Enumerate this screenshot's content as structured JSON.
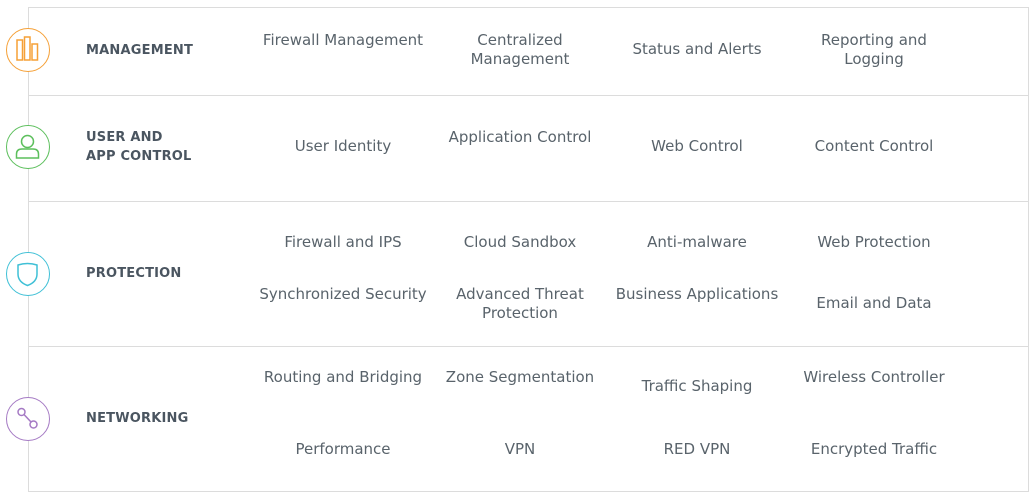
{
  "categories": {
    "management": {
      "label": "MANAGEMENT",
      "icon": "bar-chart-icon",
      "color": "#f5a037",
      "features": [
        "Firewall Management",
        "Centralized Management",
        "Status and Alerts",
        "Reporting and Logging"
      ]
    },
    "user_app_control": {
      "label_line1": "USER AND",
      "label_line2": "APP CONTROL",
      "icon": "user-icon",
      "color": "#5cbf5c",
      "features": [
        "User Identity",
        "Application Control",
        "Web Control",
        "Content Control"
      ]
    },
    "protection": {
      "label": "PROTECTION",
      "icon": "shield-icon",
      "color": "#3fc0d6",
      "features": [
        "Firewall and IPS",
        "Cloud Sandbox",
        "Anti-malware",
        "Web Protection",
        "Synchronized Security",
        "Advanced Threat Protection",
        "Business Applications",
        "Email and Data"
      ]
    },
    "networking": {
      "label": "NETWORKING",
      "icon": "network-nodes-icon",
      "color": "#a57ac4",
      "features": [
        "Routing and Bridging",
        "Zone Segmentation",
        "Traffic Shaping",
        "Wireless Controller",
        "Performance",
        "VPN",
        "RED VPN",
        "Encrypted Traffic"
      ]
    }
  }
}
